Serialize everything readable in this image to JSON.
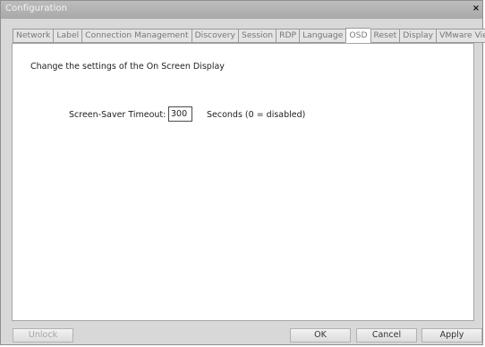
{
  "window": {
    "title": "Configuration",
    "close_label": "×"
  },
  "tabs": [
    {
      "label": "Network"
    },
    {
      "label": "Label"
    },
    {
      "label": "Connection Management"
    },
    {
      "label": "Discovery"
    },
    {
      "label": "Session"
    },
    {
      "label": "RDP"
    },
    {
      "label": "Language"
    },
    {
      "label": "OSD",
      "active": true
    },
    {
      "label": "Reset"
    },
    {
      "label": "Display"
    },
    {
      "label": "VMware View"
    }
  ],
  "panel": {
    "description": "Change the settings of the On Screen Display",
    "screensaver": {
      "label": "Screen-Saver Timeout:",
      "value": "300",
      "hint": "Seconds (0 = disabled)"
    }
  },
  "buttons": {
    "unlock": "Unlock",
    "ok": "OK",
    "cancel": "Cancel",
    "apply": "Apply"
  },
  "colors": {
    "titlebar": "#b2b2b2",
    "window_bg": "#d8d8d8",
    "panel_bg": "#ffffff"
  }
}
